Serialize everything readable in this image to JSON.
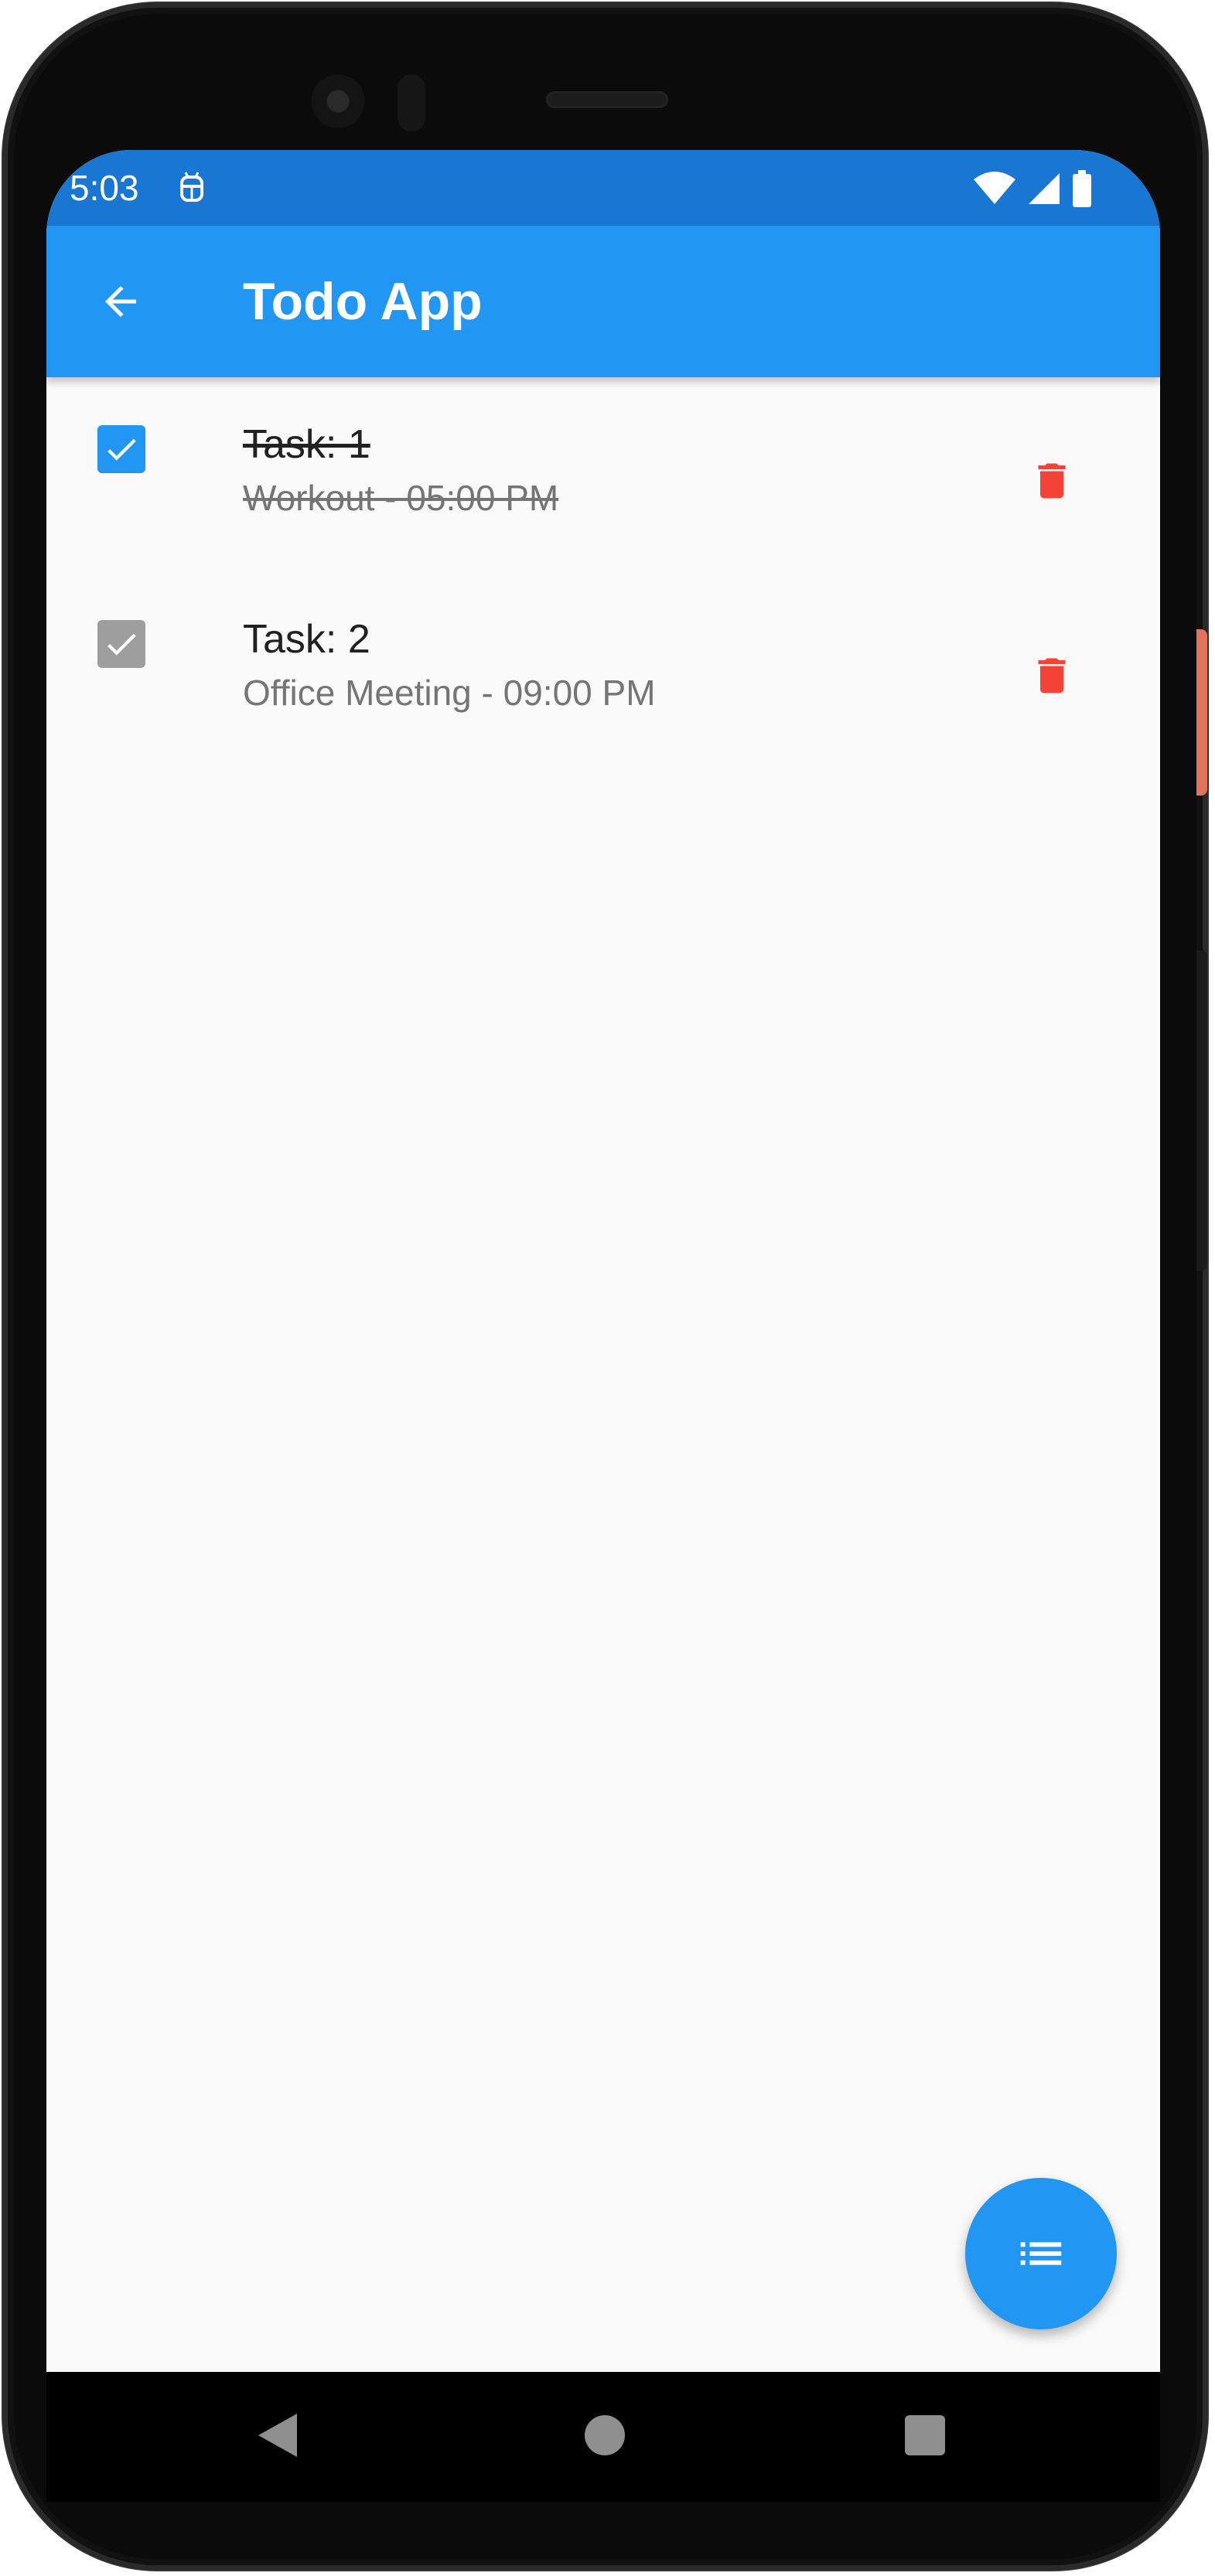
{
  "status_bar": {
    "time": "5:03"
  },
  "app_bar": {
    "title": "Todo App"
  },
  "tasks": [
    {
      "title": "Task: 1",
      "subtitle": "Workout - 05:00 PM",
      "checked": true
    },
    {
      "title": "Task: 2",
      "subtitle": "Office Meeting - 09:00 PM",
      "checked": true
    }
  ],
  "colors": {
    "primary": "#2196f3",
    "status_bar": "#1976d2",
    "delete": "#f44336",
    "checkbox_inactive": "#9e9e9e"
  },
  "icons": {
    "back": "arrow-back-icon",
    "delete": "trash-icon",
    "fab": "list-icon"
  }
}
